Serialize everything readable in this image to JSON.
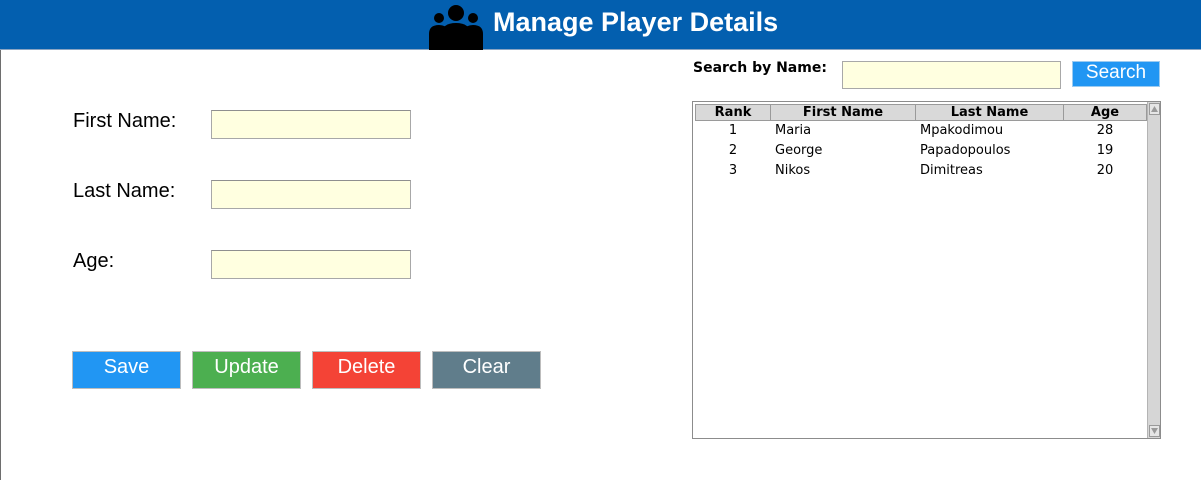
{
  "header": {
    "title": "Manage Player Details",
    "icon": "people-group-icon"
  },
  "form": {
    "first_name_label": "First Name:",
    "last_name_label": "Last Name:",
    "age_label": "Age:",
    "first_name_value": "",
    "last_name_value": "",
    "age_value": ""
  },
  "buttons": {
    "save": "Save",
    "update": "Update",
    "delete": "Delete",
    "clear": "Clear"
  },
  "search": {
    "label": "Search by Name:",
    "value": "",
    "button": "Search"
  },
  "table": {
    "headers": {
      "rank": "Rank",
      "first_name": "First Name",
      "last_name": "Last Name",
      "age": "Age"
    },
    "rows": [
      {
        "rank": "1",
        "first_name": "Maria",
        "last_name": "Mpakodimou",
        "age": "28"
      },
      {
        "rank": "2",
        "first_name": "George",
        "last_name": "Papadopoulos",
        "age": "19"
      },
      {
        "rank": "3",
        "first_name": "Nikos",
        "last_name": "Dimitreas",
        "age": "20"
      }
    ]
  },
  "colors": {
    "header_bg": "#035faf",
    "save": "#2196f3",
    "update": "#4caf50",
    "delete": "#f44336",
    "clear": "#607d8b",
    "input_bg": "#ffffe0"
  }
}
